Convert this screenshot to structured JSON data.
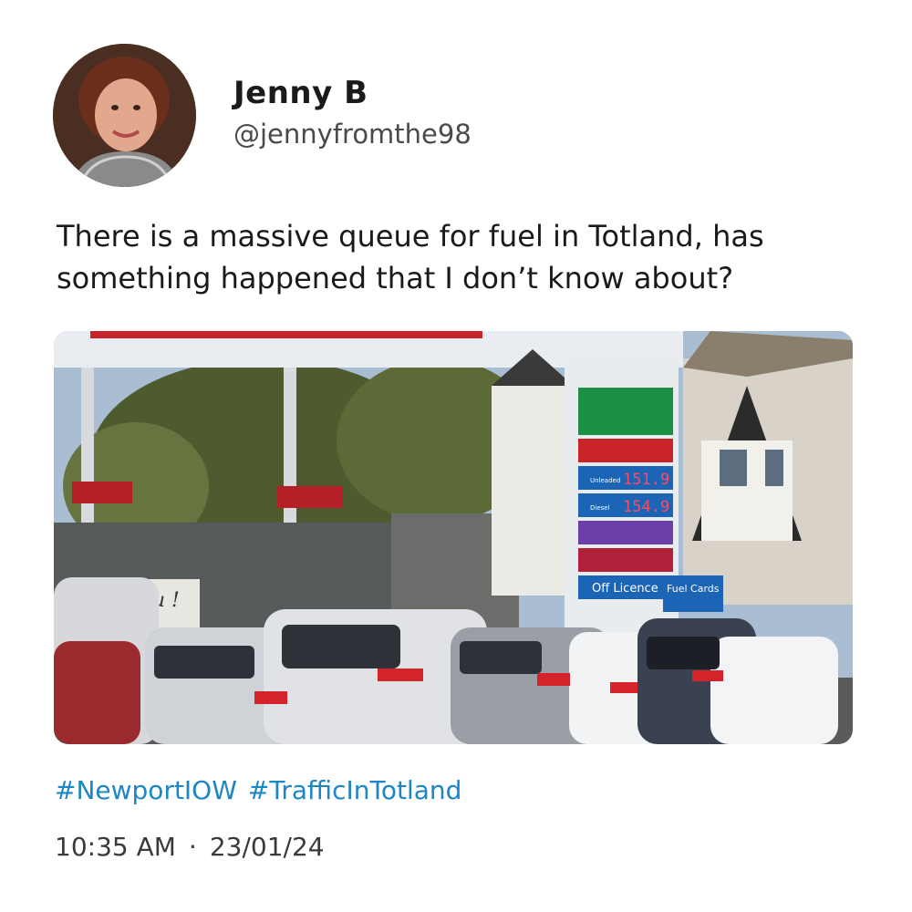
{
  "user": {
    "name": "Jenny B",
    "handle": "@jennyfromthe98"
  },
  "tweet": {
    "text": "There is a massive queue for fuel in Totland, has something happened that I don’t know about?",
    "hashtags": [
      "#NewportIOW",
      "#TrafficInTotland"
    ],
    "time": "10:35 AM",
    "separator": "·",
    "date": "23/01/24"
  },
  "photo": {
    "sign": {
      "unleaded_label": "Unleaded",
      "unleaded_price": "151.9",
      "diesel_label": "Diesel",
      "diesel_price": "154.9",
      "offlicence": "Off Licence",
      "fuelcards": "Fuel Cards",
      "you_sign": "You !"
    }
  },
  "colors": {
    "hashtag": "#1d86c4",
    "text": "#1a1a1a"
  }
}
